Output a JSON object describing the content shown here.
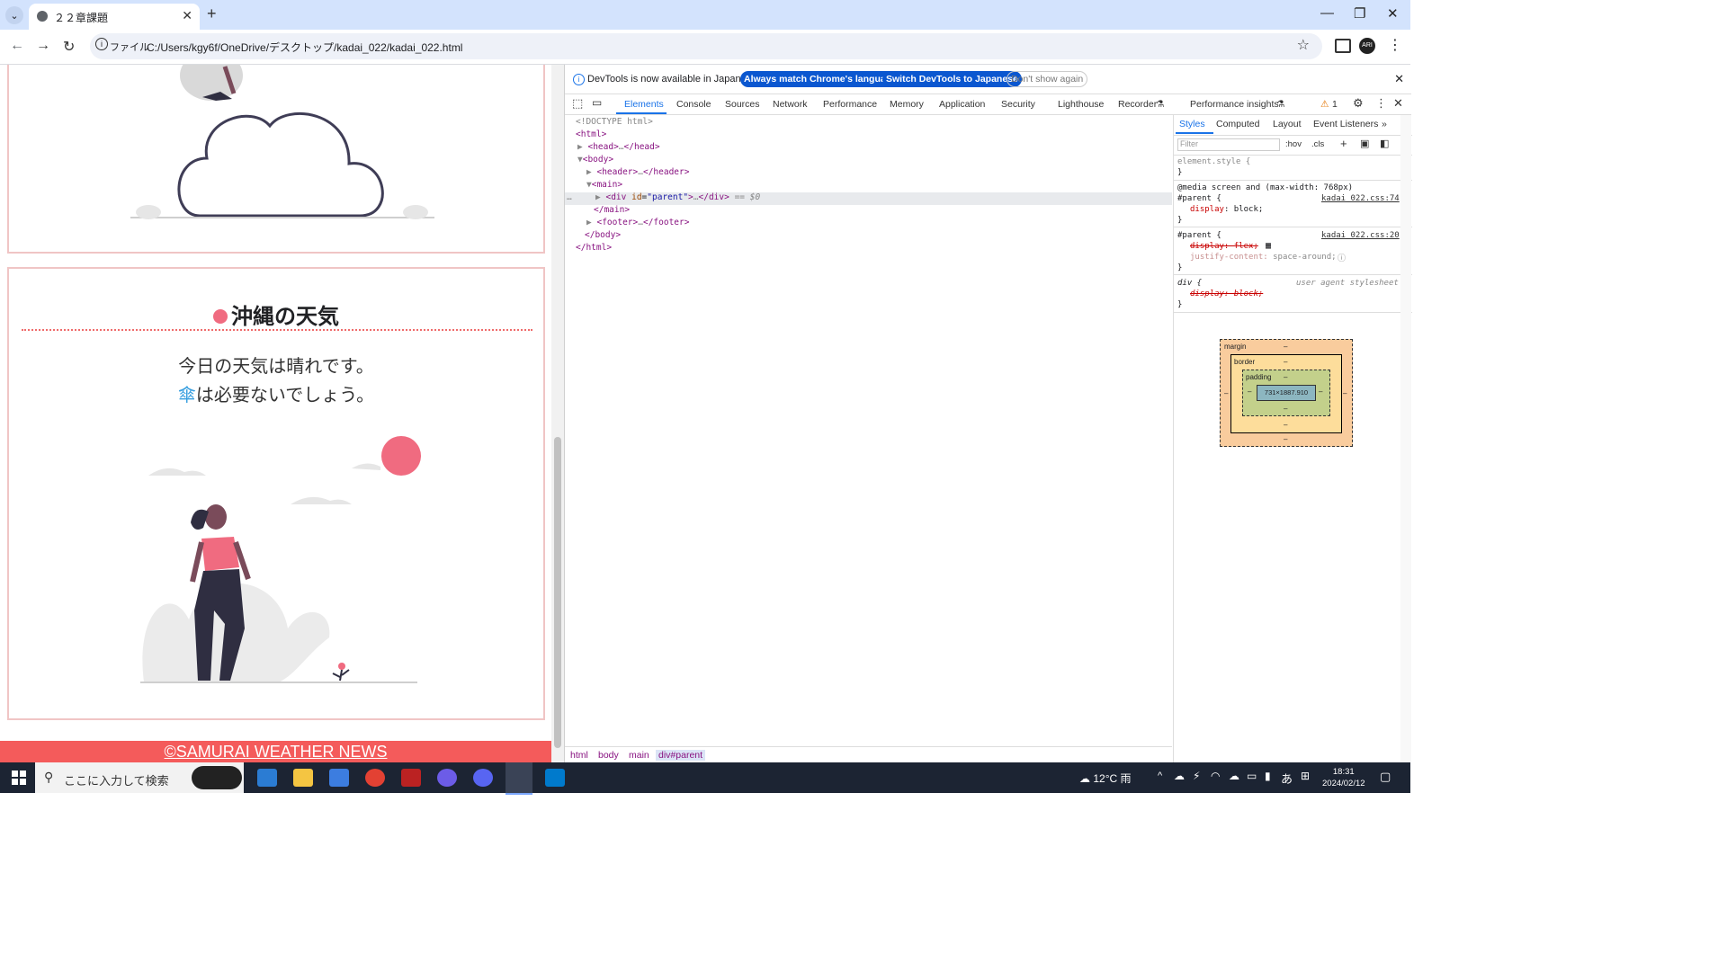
{
  "browser": {
    "tab_title": "２２章課題",
    "url_chip": "ファイル",
    "url": "C:/Users/kgy6f/OneDrive/デスクトップ/kadai_022/kadai_022.html",
    "profile_initials": "ARI"
  },
  "page": {
    "heading": "沖縄の天気",
    "line1": "今日の天気は晴れです。",
    "umbrella": "傘",
    "line2_rest": "は必要ないでしょう。",
    "footer": "©SAMURAI WEATHER NEWS",
    "accent": "#f06b80",
    "footer_bg": "#f45b5b"
  },
  "devtools": {
    "info_message": "DevTools is now available in Japanese!",
    "btn_match": "Always match Chrome's language",
    "btn_switch": "Switch DevTools to Japanese",
    "btn_dont": "Don't show again",
    "tabs": [
      "Elements",
      "Console",
      "Sources",
      "Network",
      "Performance",
      "Memory",
      "Application",
      "Security",
      "Lighthouse",
      "Recorder",
      "Performance insights"
    ],
    "warning_count": "1",
    "dom": {
      "doctype": "<!DOCTYPE html>",
      "html_open": "<html>",
      "head": "<head>",
      "head_close": "</head>",
      "body_open": "<body>",
      "header": "<header>",
      "header_close": "</header>",
      "main_open": "<main>",
      "div_open": "<div",
      "div_attr": "id",
      "div_val": "\"parent\"",
      "div_close": "</div>",
      "sel_marker": "== $0",
      "main_close": "</main>",
      "footer": "<footer>",
      "footer_close": "</footer>",
      "body_close": "</body>",
      "html_close": "</html>"
    },
    "breadcrumbs": [
      "html",
      "body",
      "main",
      "div#parent"
    ],
    "styles_tabs": [
      "Styles",
      "Computed",
      "Layout",
      "Event Listeners"
    ],
    "filter_placeholder": "Filter",
    "hov": ":hov",
    "cls": ".cls",
    "rules": {
      "element_style": "element.style {",
      "media": "@media screen and (max-width: 768px)",
      "rule1_sel": "#parent {",
      "rule1_src": "kadai_022.css:74",
      "rule1_prop": "display",
      "rule1_val": "block;",
      "rule2_sel": "#parent {",
      "rule2_src": "kadai_022.css:20",
      "rule2_p1": "display: flex;",
      "rule2_p2": "justify-content",
      "rule2_v2": "space-around;",
      "rule3_sel": "div {",
      "rule3_src": "user agent stylesheet",
      "rule3_p": "display: block;"
    },
    "box_model": {
      "margin": "margin",
      "border": "border",
      "padding": "padding",
      "dash": "–",
      "content": "731×1887.910"
    }
  },
  "taskbar": {
    "search_placeholder": "ここに入力して検索",
    "weather": "12°C 雨",
    "ime": "あ",
    "time": "18:31",
    "date": "2024/02/12"
  }
}
